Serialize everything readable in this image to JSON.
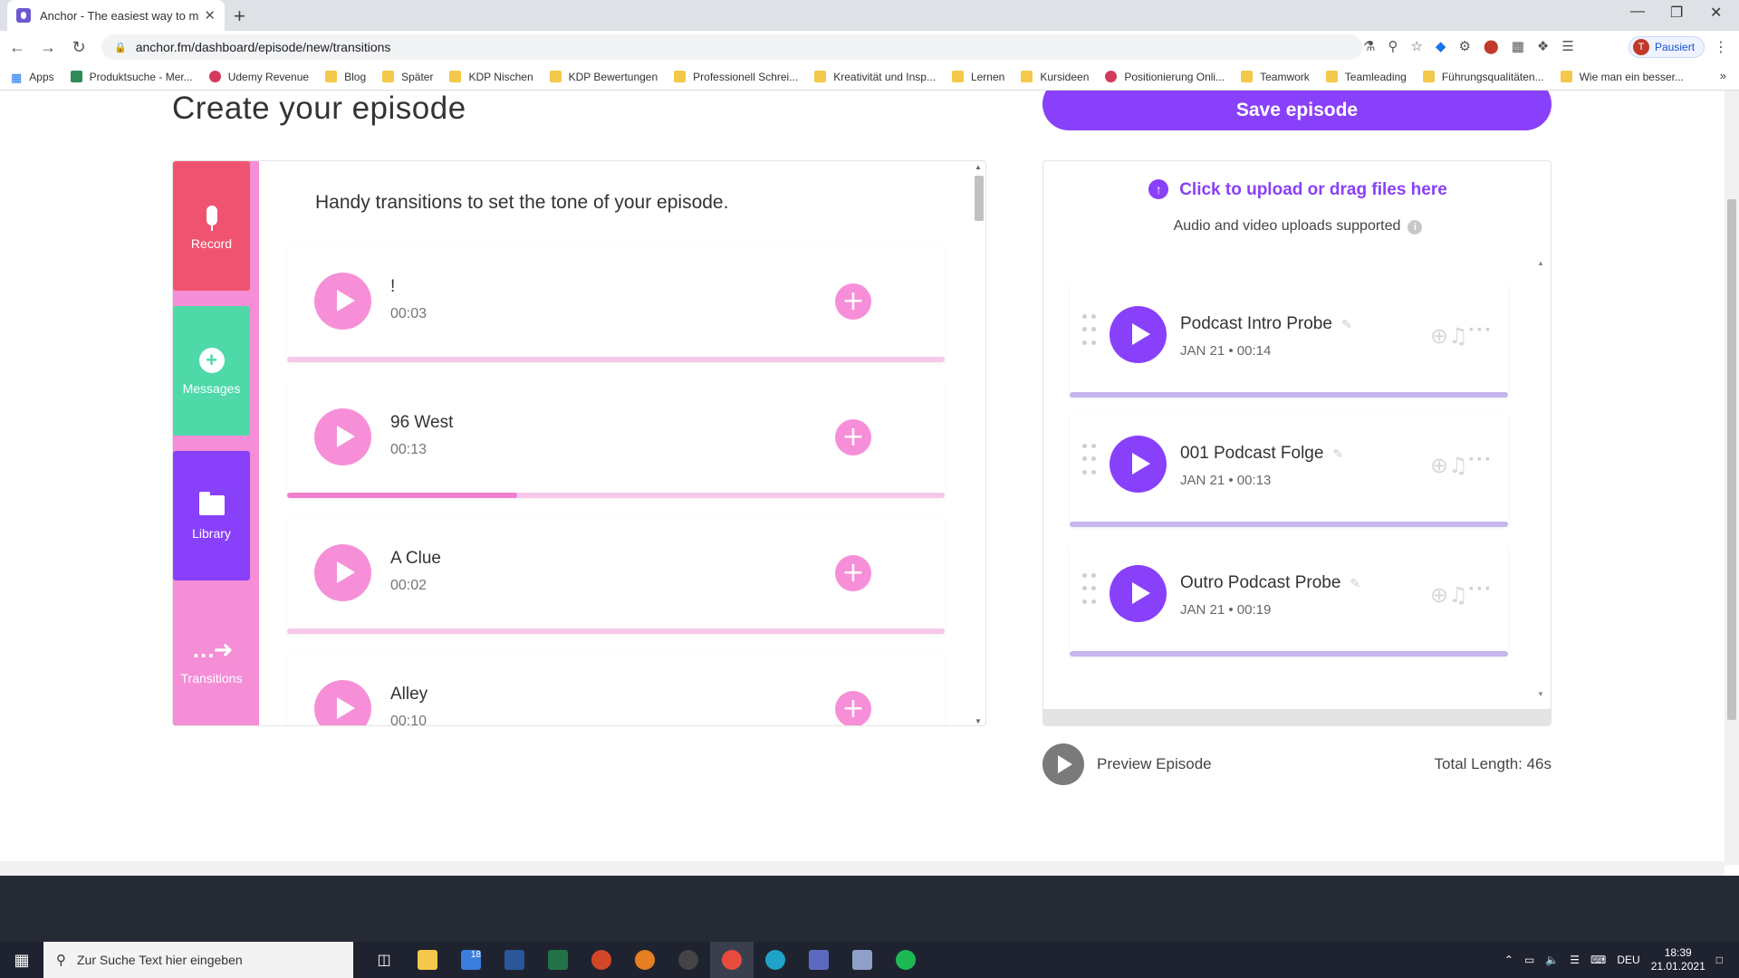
{
  "browser": {
    "tab_title": "Anchor - The easiest way to mak",
    "tab_close": "✕",
    "new_tab": "+",
    "url": "anchor.fm/dashboard/episode/new/transitions",
    "profile_initial": "T",
    "profile_label": "Pausiert",
    "bookmarks": [
      "Apps",
      "Produktsuche - Mer...",
      "Udemy Revenue",
      "Blog",
      "Später",
      "KDP Nischen",
      "KDP Bewertungen",
      "Professionell Schrei...",
      "Kreativität und Insp...",
      "Lernen",
      "Kursideen",
      "Positionierung Onli...",
      "Teamwork",
      "Teamleading",
      "Führungsqualitäten...",
      "Wie man ein besser..."
    ],
    "bookmarks_more": "»"
  },
  "page": {
    "title": "Create your episode",
    "save_label": "Save episode"
  },
  "nav": {
    "record": "Record",
    "messages": "Messages",
    "library": "Library",
    "transitions": "Transitions"
  },
  "transitions": {
    "heading": "Handy transitions to set the tone of your episode.",
    "items": [
      {
        "name": "!",
        "duration": "00:03",
        "progress": 0
      },
      {
        "name": "96 West",
        "duration": "00:13",
        "progress": 0.35
      },
      {
        "name": "A Clue",
        "duration": "00:02",
        "progress": 0
      },
      {
        "name": "Alley",
        "duration": "00:10",
        "progress": 0
      }
    ]
  },
  "upload": {
    "link": "Click to upload or drag files here",
    "note": "Audio and video uploads supported",
    "info_icon": "i"
  },
  "segments": [
    {
      "title": "Podcast Intro Probe",
      "meta": "JAN 21 • 00:14"
    },
    {
      "title": "001 Podcast Folge",
      "meta": "JAN 21 • 00:13"
    },
    {
      "title": "Outro Podcast Probe",
      "meta": "JAN 21 • 00:19"
    }
  ],
  "footer": {
    "preview_label": "Preview Episode",
    "total_length": "Total Length: 46s"
  },
  "taskbar": {
    "search_placeholder": "Zur Suche Text hier eingeben",
    "language": "DEU",
    "time": "18:39",
    "date": "21.01.2021",
    "mail_badge": "18"
  },
  "colors": {
    "accent_purple": "#8940fa",
    "pink": "#f58ed6",
    "record_red": "#ef5370",
    "messages_green": "#4fd9a8"
  }
}
